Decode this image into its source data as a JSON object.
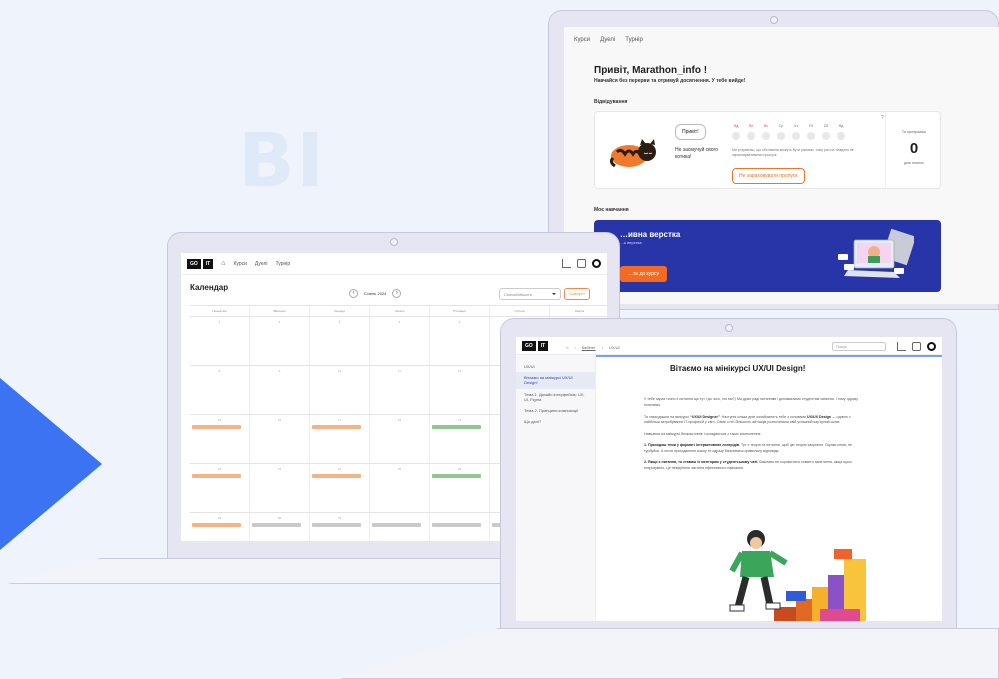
{
  "background_text": "BI",
  "dashboard": {
    "nav": [
      "Курси",
      "Дуелі",
      "Турнір"
    ],
    "greeting": "Привіт, Marathon_info !",
    "subtitle": "Навчайся без перерви та отримуй досягнення. У тебе вийде!",
    "attendance_title": "Відвідування",
    "cat_speech": "Привіт!",
    "cat_message": "Не засмучуй свого котика!",
    "weekdays": [
      "Нд",
      "Пн",
      "Вт",
      "Ср",
      "Чт",
      "Пт",
      "Сб",
      "Нд"
    ],
    "attendance_note": "Ми розуміємо, що обставини можуть бути різними, тому раз на тиждень не зараховуватимемо пропуск.",
    "miss_button": "Не зараховувати пропуск",
    "question_mark": "?",
    "skipped_label": "Ти пропускаєш",
    "skipped_count": "0",
    "skipped_days": "днів поспіль",
    "learning_title": "Моє навчання",
    "course_title": "…ивна верстка",
    "course_sub": "…ь верстка",
    "course_button": "…ти до курсу"
  },
  "calendar": {
    "logo_left": "GO",
    "logo_right": "IT",
    "nav": [
      "Курси",
      "Дуелі",
      "Турнір"
    ],
    "title": "Календар",
    "month": "Січень 2024",
    "prev": "‹",
    "next": "›",
    "filter": "Спосабобшити",
    "button": "Скинути",
    "weekdays": [
      "Понеділок",
      "Вівторок",
      "Середа",
      "Четвер",
      "П'ятниця",
      "Субота",
      "Неділя"
    ],
    "weeks": [
      {
        "days": [
          "1",
          "2",
          "3",
          "4",
          "5",
          "6",
          "7"
        ],
        "events": [
          "",
          "",
          "",
          "",
          "",
          "",
          ""
        ]
      },
      {
        "days": [
          "8",
          "9",
          "10",
          "11",
          "12",
          "13",
          "14"
        ],
        "events": [
          "",
          "",
          "",
          "",
          "",
          "",
          ""
        ]
      },
      {
        "days": [
          "15",
          "16",
          "17",
          "18",
          "19",
          "20",
          "21"
        ],
        "events": [
          "o",
          "",
          "o",
          "",
          "g",
          "",
          ""
        ]
      },
      {
        "days": [
          "22",
          "23",
          "24",
          "25",
          "26",
          "27",
          "28"
        ],
        "events": [
          "o",
          "",
          "o",
          "",
          "g",
          "",
          ""
        ]
      },
      {
        "days": [
          "29",
          "30",
          "31",
          "",
          "",
          "",
          ""
        ],
        "events": [
          "o",
          "s",
          "s",
          "s",
          "s",
          "s",
          "s"
        ]
      }
    ]
  },
  "course_page": {
    "logo_left": "GO",
    "logo_right": "IT",
    "breadcrumb_link": "Кабінет",
    "breadcrumb_current": "UX/UI",
    "search_placeholder": "Пошук",
    "sidebar_group": "UX/UI",
    "sidebar": [
      "Вітаємо на мінікурсі UX/UI Design!",
      "Тема 1. Дизайн інтерфейсів: UX, UI, Figma",
      "Тема 2. Принципи композиції",
      "Що далі?"
    ],
    "heading": "Вітаємо на мінікурсі UX/UI Design!",
    "p1": "У тебе зараз точно є питання що тут і до чого, хто ми?) Ми дуже раді питанням і допомагаємо студентам загалом. І тому одразу пояснимо.",
    "p2_pre": "Ти знаходишся на мінікурсі ",
    "p2_bold1": "“UX/UI Designer”",
    "p2_mid": ". Наступні кілька днів ознайомлять тебе з основами ",
    "p2_bold2": "UX/UX Design",
    "p2_post": " — однією з найбільш затребуваних IT-професій у світі. Саме з неї більшість айтішців розпочинали свій успішний кар'єрний шлях.",
    "p3": "Навчання на мінікурсі безкоштовне і складається з таких компонентів:",
    "p4_bold": "1. Проходиш теми у форматі інтерактивних лонгрідів.",
    "p4": " Тут є теорія та питання, щоб цю теорію закріпити. Оцінки нема, не турбуйся. А після проходження кожну ти одразу бачитимеш правильну відповідь.",
    "p5_bold": "2. Якщо є питання, то ставиш їх менторам у студентському чаті.",
    "p5": " Важливо не соромитися ставити запитання, якщо щось незрозуміло. Це невід'ємна частина ефективного навчання."
  }
}
